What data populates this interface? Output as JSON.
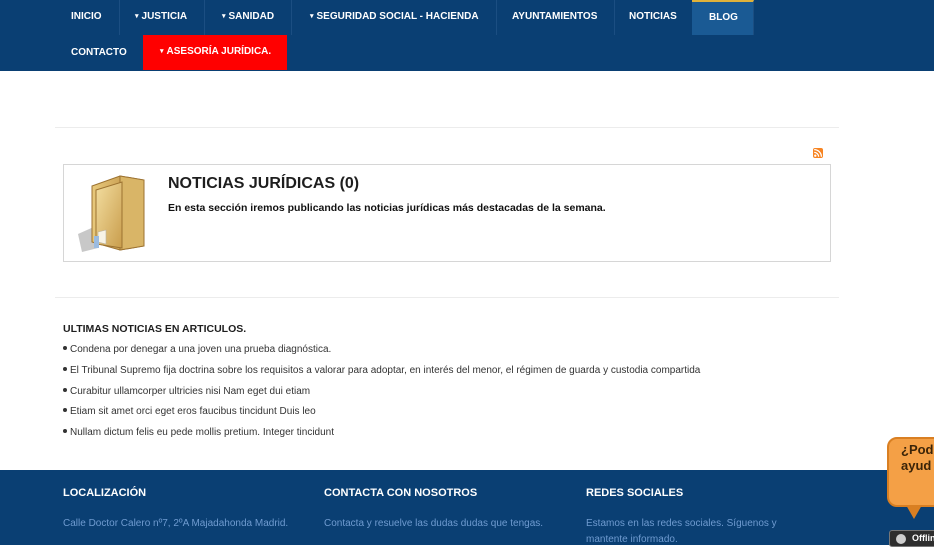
{
  "nav": {
    "items": [
      {
        "label": "INICIO",
        "dropdown": false
      },
      {
        "label": "JUSTICIA",
        "dropdown": true
      },
      {
        "label": "SANIDAD",
        "dropdown": true
      },
      {
        "label": "SEGURIDAD SOCIAL - HACIENDA",
        "dropdown": true
      },
      {
        "label": "AYUNTAMIENTOS",
        "dropdown": false
      },
      {
        "label": "NOTICIAS",
        "dropdown": false
      },
      {
        "label": "BLOG",
        "dropdown": false,
        "active": true
      },
      {
        "label": "CONTACTO",
        "dropdown": false
      },
      {
        "label": "ASESORÍA JURÍDICA.",
        "dropdown": true,
        "highlighted": true
      }
    ],
    "caret_glyph": "▾",
    "colors": {
      "bar": "#0a3f73",
      "active": "#1a5a94",
      "highlight": "#ff0000"
    }
  },
  "rss": {
    "icon": "rss-feed-icon"
  },
  "category": {
    "icon": "folder-icon",
    "title": "NOTICIAS JURÍDICAS (0)",
    "description": "En esta sección iremos publicando las noticias jurídicas más destacadas de la semana."
  },
  "latest": {
    "heading": "ULTIMAS NOTICIAS EN ARTICULOS.",
    "items": [
      "Condena por denegar a una joven una prueba diagnóstica.",
      "El Tribunal Supremo fija doctrina sobre los requisitos a valorar para adoptar, en interés del menor, el régimen de guarda y custodia compartida",
      "Curabitur ullamcorper ultricies nisi Nam eget dui etiam",
      "Etiam sit amet orci eget eros faucibus tincidunt Duis leo",
      "Nullam dictum felis eu pede mollis pretium. Integer tincidunt"
    ]
  },
  "footer": {
    "localizacion": {
      "title": "LOCALIZACIÓN",
      "text": "Calle Doctor Calero nº7, 2ºA Majadahonda Madrid."
    },
    "contacta": {
      "title": "CONTACTA CON NOSOTROS",
      "text": "Contacta y resuelve las dudas dudas que tengas."
    },
    "redes": {
      "title": "REDES SOCIALES",
      "text": "Estamos en las redes sociales. Síguenos y mantente informado."
    },
    "colors": {
      "background": "#0a3f73",
      "link_text": "#6f9bd0"
    }
  },
  "chat": {
    "bubble_line1": "¿Pod",
    "bubble_line2": "ayud",
    "offline_label": "Offlin",
    "colors": {
      "bubble": "#f4a046",
      "offline_bg": "#2e2e2e"
    }
  }
}
